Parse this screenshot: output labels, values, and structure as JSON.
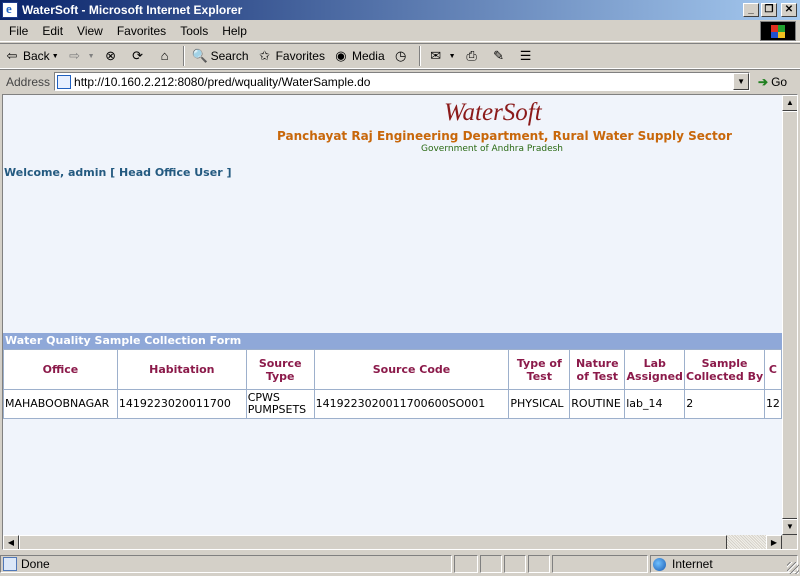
{
  "window": {
    "title": "WaterSoft - Microsoft Internet Explorer",
    "minimize": "_",
    "maximize": "❐",
    "close": "✕"
  },
  "menu": [
    "File",
    "Edit",
    "View",
    "Favorites",
    "Tools",
    "Help"
  ],
  "toolbar": {
    "back": "Back",
    "search": "Search",
    "favorites": "Favorites",
    "media": "Media"
  },
  "address": {
    "label": "Address",
    "url": "http://10.160.2.212:8080/pred/wquality/WaterSample.do",
    "go": "Go"
  },
  "page": {
    "brand": "WaterSoft",
    "subtitle": "Panchayat Raj Engineering Department, Rural Water Supply Sector",
    "govt": "Government of Andhra Pradesh",
    "welcome": "Welcome, admin [ Head Office User ]",
    "form_title": "Water Quality Sample Collection Form",
    "columns": [
      "Office",
      "Habitation",
      "Source Type",
      "Source Code",
      "Type of Test",
      "Nature of Test",
      "Lab Assigned",
      "Sample Collected By",
      "C"
    ],
    "rows": [
      [
        "MAHABOOBNAGAR",
        "1419223020011700",
        "CPWS PUMPSETS",
        "1419223020011700600SO001",
        "PHYSICAL",
        "ROUTINE",
        "lab_14",
        "2",
        "12"
      ]
    ]
  },
  "status": {
    "text": "Done",
    "zone": "Internet"
  }
}
